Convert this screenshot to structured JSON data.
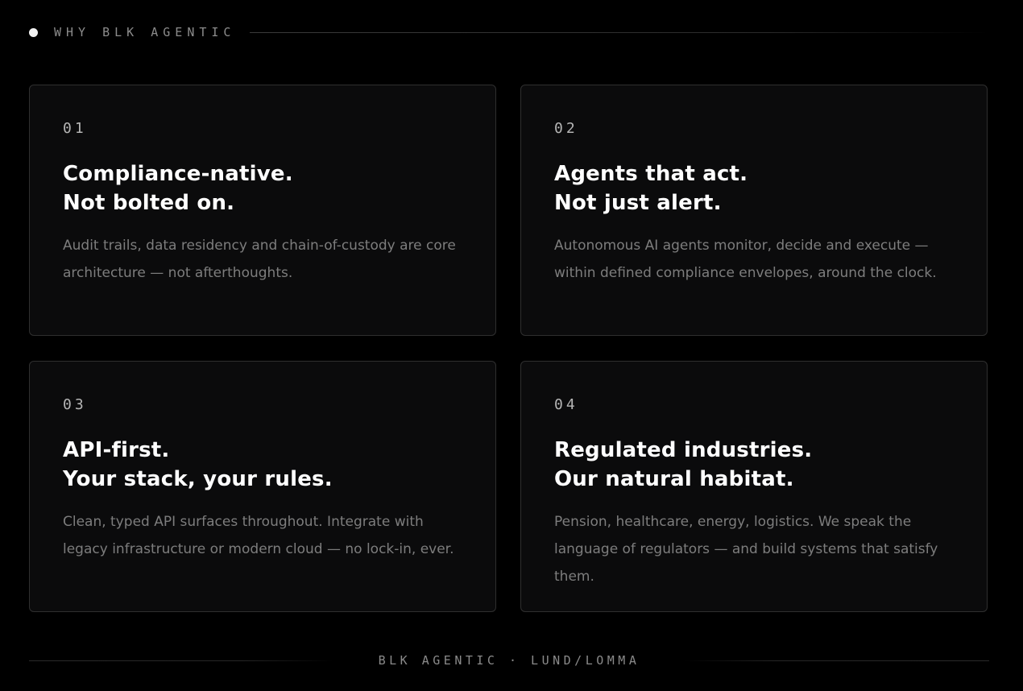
{
  "header": {
    "eyebrow": "WHY BLK AGENTIC",
    "dot_icon": "bullet-dot-icon"
  },
  "cards": [
    {
      "number": "01",
      "title_line1": "Compliance-native.",
      "title_line2": "Not bolted on.",
      "description": "Audit trails, data residency and chain-of-custody are core architecture — not afterthoughts."
    },
    {
      "number": "02",
      "title_line1": "Agents that act.",
      "title_line2": "Not just alert.",
      "description": "Autonomous AI agents monitor, decide and execute — within defined compliance envelopes, around the clock."
    },
    {
      "number": "03",
      "title_line1": "API-first.",
      "title_line2": "Your stack, your rules.",
      "description": "Clean, typed API surfaces throughout. Integrate with legacy infrastructure or modern cloud — no lock-in, ever."
    },
    {
      "number": "04",
      "title_line1": "Regulated industries.",
      "title_line2": "Our natural habitat.",
      "description": "Pension, healthcare, energy, logistics. We speak the language of regulators — and build systems that satisfy them."
    }
  ],
  "footer": {
    "text": "BLK AGENTIC · LUND/LOMMA"
  },
  "colors": {
    "background": "#000000",
    "card_background": "#0b0b0c",
    "card_border": "#2f2f2f",
    "title": "#ffffff",
    "body_text": "#7d7d7d",
    "muted_label": "#8c8c8c"
  }
}
